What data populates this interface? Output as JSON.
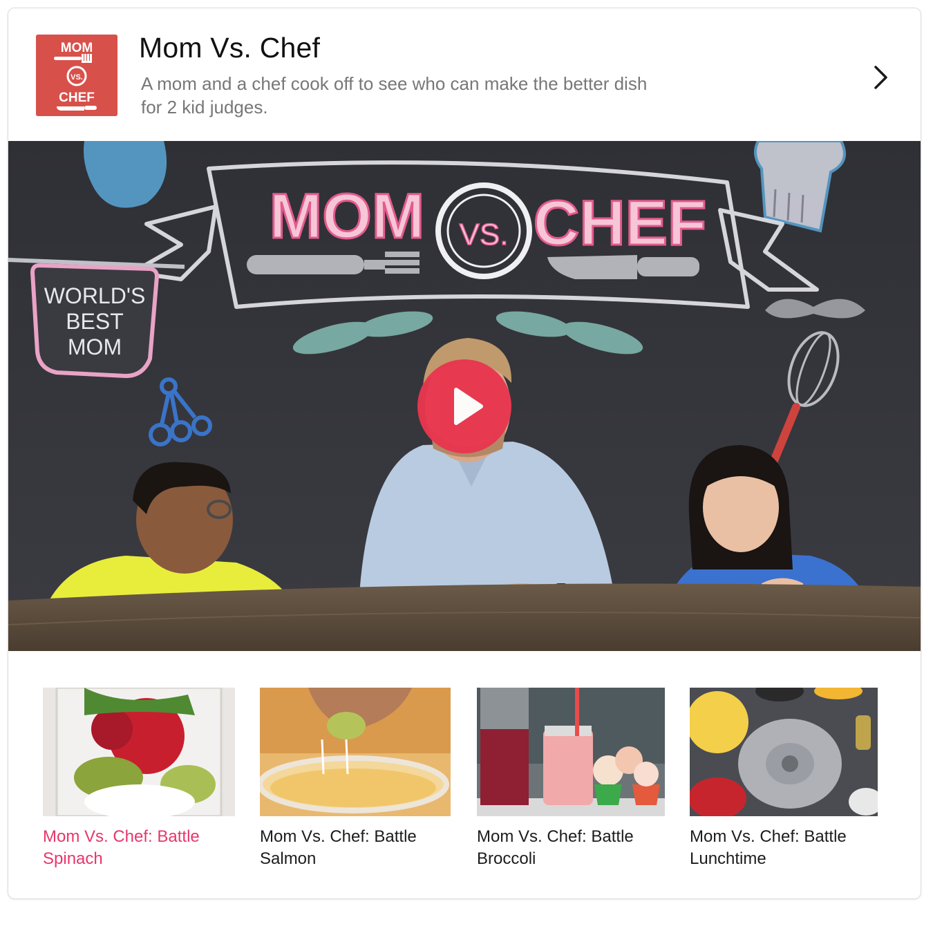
{
  "show": {
    "logo": {
      "top": "MOM",
      "middle": "VS.",
      "bottom": "CHEF",
      "background": "#d8504a"
    },
    "title": "Mom Vs. Chef",
    "description": "A mom and a chef cook off to see who can make the better dish for 2 kid judges.",
    "next_icon": "chevron-right-icon"
  },
  "featured_video": {
    "chalk_banner": {
      "left": "MOM",
      "middle": "VS.",
      "right": "CHEF"
    },
    "apron_text": [
      "WORLD'S",
      "BEST",
      "MOM"
    ],
    "play_icon": "play-icon",
    "play_color": "#e8364f"
  },
  "episodes": [
    {
      "title": "Mom Vs. Chef: Battle Spinach",
      "active": true
    },
    {
      "title": "Mom Vs. Chef: Battle Salmon",
      "active": false
    },
    {
      "title": "Mom Vs. Chef: Battle Broccoli",
      "active": false
    },
    {
      "title": "Mom Vs. Chef: Battle Lunchtime",
      "active": false
    }
  ],
  "colors": {
    "accent_pink": "#e8366a",
    "title_text": "#111111",
    "description_text": "#777777"
  }
}
